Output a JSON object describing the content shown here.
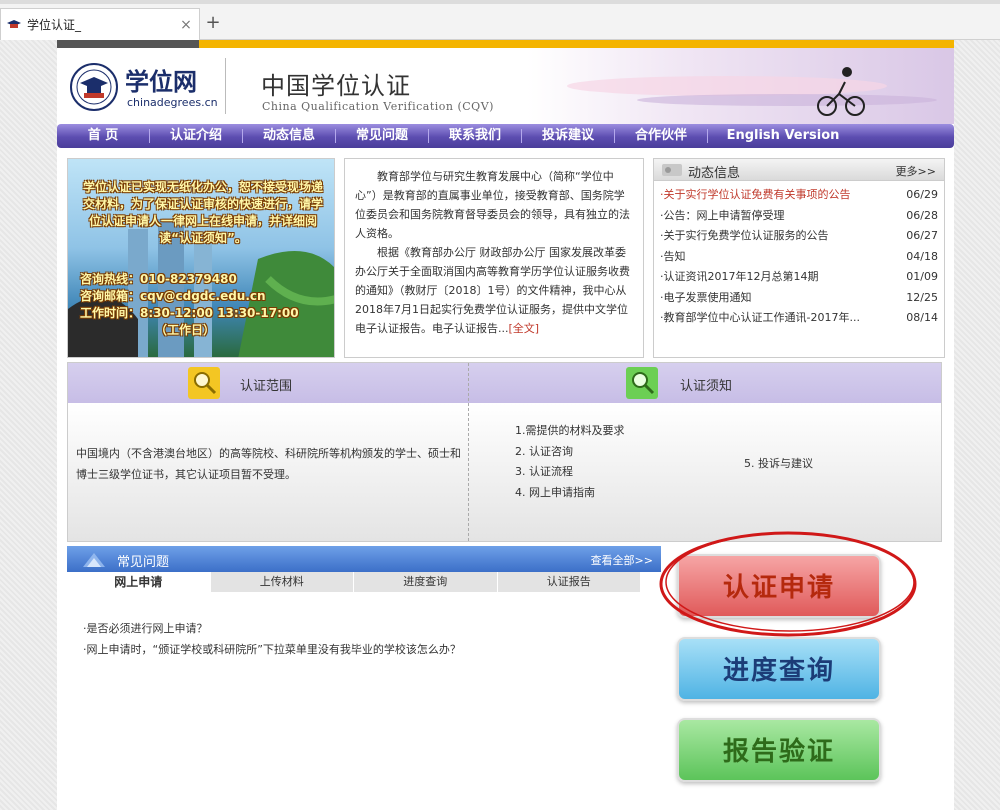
{
  "browser": {
    "tab_title": "学位认证_",
    "close_glyph": "×",
    "new_tab_glyph": "+"
  },
  "header": {
    "logo_cn": "学位网",
    "logo_en": "chinadegrees.cn",
    "site_cn": "中国学位认证",
    "site_en": "China Qualification Verification (CQV)"
  },
  "nav": {
    "items": [
      "首 页",
      "认证介绍",
      "动态信息",
      "常见问题",
      "联系我们",
      "投诉建议",
      "合作伙伴",
      "English Version"
    ]
  },
  "promo": {
    "text": "学位认证已实现无纸化办公，恕不接受现场递交材料，为了保证认证审核的快速进行，请学位认证申请人一律网上在线申请，并详细阅读“认证须知”。",
    "hotline": "咨询热线：010-82379480",
    "email": "咨询邮箱：cqv@cdgdc.edu.cn",
    "hours": "工作时间：8:30-12:00 13:30-17:00",
    "days": "（工作日）"
  },
  "intro": {
    "para1": "教育部学位与研究生教育发展中心（简称“学位中心”）是教育部的直属事业单位，接受教育部、国务院学位委员会和国务院教育督导委员会的领导，具有独立的法人资格。",
    "para2": "根据《教育部办公厅 财政部办公厅 国家发展改革委办公厅关于全面取消国内高等教育学历学位认证服务收费的通知》（教财厅〔2018〕1号）的文件精神，我中心从2018年7月1日起实行免费学位认证服务，提供中文学位电子认证报告。电子认证报告...",
    "more": "[全文]"
  },
  "news": {
    "title": "动态信息",
    "more": "更多>>",
    "items": [
      {
        "title": "·关于实行学位认证免费有关事项的公告",
        "date": "06/29"
      },
      {
        "title": "·公告：网上申请暂停受理",
        "date": "06/28"
      },
      {
        "title": "·关于实行免费学位认证服务的公告",
        "date": "06/27"
      },
      {
        "title": "·告知",
        "date": "04/18"
      },
      {
        "title": "·认证资讯2017年12月总第14期",
        "date": "01/09"
      },
      {
        "title": "·电子发票使用通知",
        "date": "12/25"
      },
      {
        "title": "·教育部学位中心认证工作通讯-2017年...",
        "date": "08/14"
      }
    ]
  },
  "scope": {
    "title": "认证范围",
    "text": "中国境内（不含港澳台地区）的高等院校、科研院所等机构颁发的学士、硕士和博士三级学位证书，其它认证项目暂不受理。"
  },
  "guide": {
    "title": "认证须知",
    "items": [
      "1.需提供的材料及要求",
      "2. 认证咨询",
      "3. 认证流程",
      "4. 网上申请指南"
    ],
    "item5": "5. 投诉与建议"
  },
  "faq": {
    "title": "常见问题",
    "more": "查看全部>>",
    "tabs": [
      "网上申请",
      "上传材料",
      "进度查询",
      "认证报告"
    ],
    "items": [
      "·是否必须进行网上申请？",
      "·网上申请时，“颁证学校或科研院所”下拉菜单里没有我毕业的学校该怎么办？"
    ]
  },
  "buttons": {
    "apply": "认证申请",
    "progress": "进度查询",
    "verify": "报告验证"
  }
}
